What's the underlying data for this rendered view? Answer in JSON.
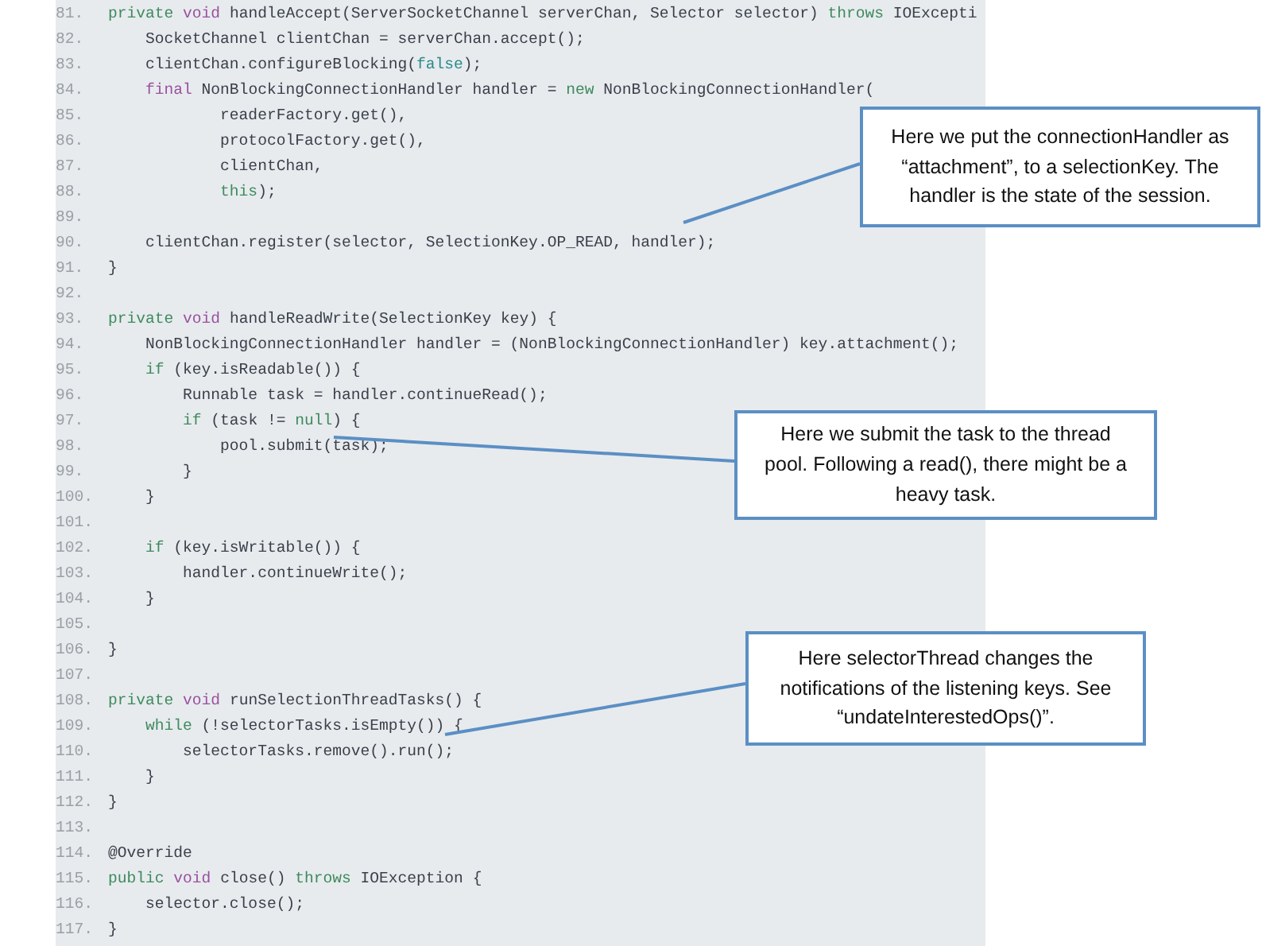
{
  "code_lines": [
    {
      "number": "81.",
      "parts": [
        {
          "kind": "mod",
          "t": "private "
        },
        {
          "kind": "type",
          "t": "void "
        },
        {
          "kind": "plain",
          "t": "handleAccept(ServerSocketChannel serverChan, Selector selector) "
        },
        {
          "kind": "mod",
          "t": "throws "
        },
        {
          "kind": "plain",
          "t": "IOExcepti"
        }
      ]
    },
    {
      "number": "82.",
      "parts": [
        {
          "kind": "plain",
          "t": "    SocketChannel clientChan = serverChan.accept();"
        }
      ]
    },
    {
      "number": "83.",
      "parts": [
        {
          "kind": "plain",
          "t": "    clientChan.configureBlocking("
        },
        {
          "kind": "lit",
          "t": "false"
        },
        {
          "kind": "plain",
          "t": ");"
        }
      ]
    },
    {
      "number": "84.",
      "parts": [
        {
          "kind": "type",
          "t": "    final "
        },
        {
          "kind": "plain",
          "t": "NonBlockingConnectionHandler handler = "
        },
        {
          "kind": "mod",
          "t": "new "
        },
        {
          "kind": "plain",
          "t": "NonBlockingConnectionHandler("
        }
      ]
    },
    {
      "number": "85.",
      "parts": [
        {
          "kind": "plain",
          "t": "            readerFactory.get(),"
        }
      ]
    },
    {
      "number": "86.",
      "parts": [
        {
          "kind": "plain",
          "t": "            protocolFactory.get(),"
        }
      ]
    },
    {
      "number": "87.",
      "parts": [
        {
          "kind": "plain",
          "t": "            clientChan,"
        }
      ]
    },
    {
      "number": "88.",
      "parts": [
        {
          "kind": "mod",
          "t": "            this"
        },
        {
          "kind": "plain",
          "t": ");"
        }
      ]
    },
    {
      "number": "89."
    },
    {
      "number": "90.",
      "parts": [
        {
          "kind": "plain",
          "t": "    clientChan.register(selector, SelectionKey.OP_READ, handler);"
        }
      ]
    },
    {
      "number": "91.",
      "parts": [
        {
          "kind": "plain",
          "t": "}"
        }
      ]
    },
    {
      "number": "92."
    },
    {
      "number": "93.",
      "parts": [
        {
          "kind": "mod",
          "t": "private "
        },
        {
          "kind": "type",
          "t": "void "
        },
        {
          "kind": "plain",
          "t": "handleReadWrite(SelectionKey key) {"
        }
      ]
    },
    {
      "number": "94.",
      "parts": [
        {
          "kind": "plain",
          "t": "    NonBlockingConnectionHandler handler = (NonBlockingConnectionHandler) key.attachment();"
        }
      ]
    },
    {
      "number": "95.",
      "parts": [
        {
          "kind": "mod",
          "t": "    if "
        },
        {
          "kind": "plain",
          "t": "(key.isReadable()) {"
        }
      ]
    },
    {
      "number": "96.",
      "parts": [
        {
          "kind": "plain",
          "t": "        Runnable task = handler.continueRead();"
        }
      ]
    },
    {
      "number": "97.",
      "parts": [
        {
          "kind": "mod",
          "t": "        if "
        },
        {
          "kind": "plain",
          "t": "(task != "
        },
        {
          "kind": "mod",
          "t": "null"
        },
        {
          "kind": "plain",
          "t": ") {"
        }
      ]
    },
    {
      "number": "98.",
      "parts": [
        {
          "kind": "plain",
          "t": "            pool.submit(task);"
        }
      ]
    },
    {
      "number": "99.",
      "parts": [
        {
          "kind": "plain",
          "t": "        }"
        }
      ]
    },
    {
      "number": "100.",
      "parts": [
        {
          "kind": "plain",
          "t": "    }"
        }
      ]
    },
    {
      "number": "101."
    },
    {
      "number": "102.",
      "parts": [
        {
          "kind": "mod",
          "t": "    if "
        },
        {
          "kind": "plain",
          "t": "(key.isWritable()) {"
        }
      ]
    },
    {
      "number": "103.",
      "parts": [
        {
          "kind": "plain",
          "t": "        handler.continueWrite();"
        }
      ]
    },
    {
      "number": "104.",
      "parts": [
        {
          "kind": "plain",
          "t": "    }"
        }
      ]
    },
    {
      "number": "105."
    },
    {
      "number": "106.",
      "parts": [
        {
          "kind": "plain",
          "t": "}"
        }
      ]
    },
    {
      "number": "107."
    },
    {
      "number": "108.",
      "parts": [
        {
          "kind": "mod",
          "t": "private "
        },
        {
          "kind": "type",
          "t": "void "
        },
        {
          "kind": "plain",
          "t": "runSelectionThreadTasks() {"
        }
      ]
    },
    {
      "number": "109.",
      "parts": [
        {
          "kind": "mod",
          "t": "    while "
        },
        {
          "kind": "plain",
          "t": "(!selectorTasks.isEmpty()) {"
        }
      ]
    },
    {
      "number": "110.",
      "parts": [
        {
          "kind": "plain",
          "t": "        selectorTasks.remove().run();"
        }
      ]
    },
    {
      "number": "111.",
      "parts": [
        {
          "kind": "plain",
          "t": "    }"
        }
      ]
    },
    {
      "number": "112.",
      "parts": [
        {
          "kind": "plain",
          "t": "}"
        }
      ]
    },
    {
      "number": "113."
    },
    {
      "number": "114.",
      "parts": [
        {
          "kind": "plain",
          "t": "@Override"
        }
      ]
    },
    {
      "number": "115.",
      "parts": [
        {
          "kind": "mod",
          "t": "public "
        },
        {
          "kind": "type",
          "t": "void "
        },
        {
          "kind": "plain",
          "t": "close() "
        },
        {
          "kind": "mod",
          "t": "throws "
        },
        {
          "kind": "plain",
          "t": "IOException {"
        }
      ]
    },
    {
      "number": "116.",
      "parts": [
        {
          "kind": "plain",
          "t": "    selector.close();"
        }
      ]
    },
    {
      "number": "117.",
      "parts": [
        {
          "kind": "plain",
          "t": "}"
        }
      ]
    }
  ],
  "callouts": [
    {
      "text": "Here we put the connectionHandler as “attachment”, to a selectionKey. The handler is the state of the session."
    },
    {
      "text": "Here we submit the task to the thread pool. Following a read(), there might be a heavy task."
    },
    {
      "text": "Here selectorThread changes the notifications of the listening keys. See “undateInterestedOps()”."
    }
  ]
}
